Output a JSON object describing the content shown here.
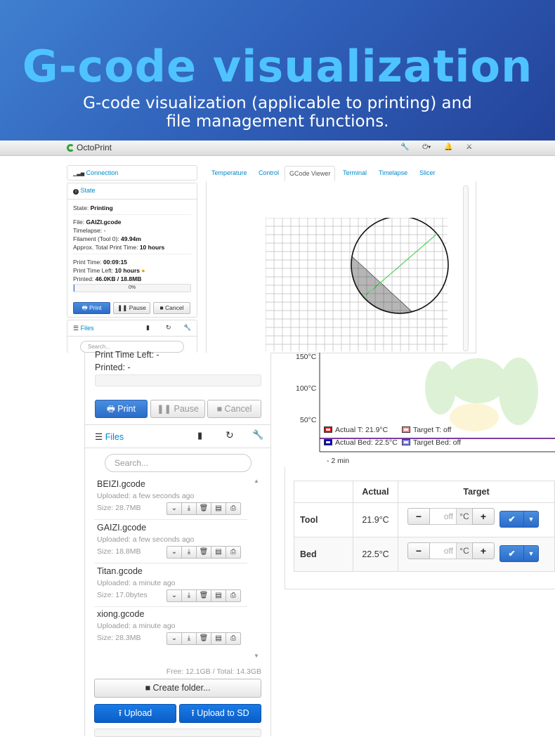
{
  "hero": {
    "title": "G-code visualization",
    "subtitle": "G-code visualization (applicable to printing) and file management functions."
  },
  "navbar": {
    "brand": "OctoPrint",
    "icons": [
      "wrench-icon",
      "power-icon",
      "bell-icon",
      "user-icon"
    ]
  },
  "small_panel": {
    "connection_label": "Connection",
    "state_label": "State",
    "state_row": "Printing",
    "state_prefix": "State:",
    "file_prefix": "File:",
    "file_value": "GAIZI.gcode",
    "timelapse_prefix": "Timelapse:",
    "timelapse_value": "-",
    "filament_prefix": "Filament (Tool 0):",
    "filament_value": "49.94m",
    "approx_prefix": "Approx. Total Print Time:",
    "approx_value": "10 hours",
    "print_time_prefix": "Print Time:",
    "print_time_value": "00:09:15",
    "time_left_prefix": "Print Time Left:",
    "time_left_value": "10 hours",
    "printed_prefix": "Printed:",
    "printed_value": "46.0KB / 18.8MB",
    "progress_text": "0%",
    "progress": 0.0,
    "print_btn": "Print",
    "pause_btn": "Pause",
    "cancel_btn": "Cancel",
    "files_label": "Files",
    "search_placeholder": "Search..."
  },
  "tabs": [
    "Temperature",
    "Control",
    "GCode Viewer",
    "Terminal",
    "Timelapse",
    "Slicer"
  ],
  "big_panel": {
    "time_left_label": "Print Time Left: -",
    "printed_label": "Printed: -",
    "print_btn": "Print",
    "pause_btn": "Pause",
    "cancel_btn": "Cancel",
    "files_label": "Files",
    "search_placeholder": "Search...",
    "files": [
      {
        "name": "BEIZI.gcode",
        "uploaded": "Uploaded: a few seconds ago",
        "size": "Size: 28.7MB"
      },
      {
        "name": "GAIZI.gcode",
        "uploaded": "Uploaded: a few seconds ago",
        "size": "Size: 18.8MB"
      },
      {
        "name": "Titan.gcode",
        "uploaded": "Uploaded: a minute ago",
        "size": "Size: 17.0bytes"
      },
      {
        "name": "xiong.gcode",
        "uploaded": "Uploaded: a minute ago",
        "size": "Size: 28.3MB"
      }
    ],
    "free_total": "Free: 12.1GB / Total: 14.3GB",
    "create_folder": "Create folder...",
    "upload": "Upload",
    "upload_sd": "Upload to SD"
  },
  "chart_data": {
    "type": "line",
    "y_ticks": [
      "150°C",
      "100°C",
      "50°C"
    ],
    "x_label": "- 2 min",
    "legend": [
      "Actual T: 21.9°C",
      "Target T: off",
      "Actual Bed: 22.5°C",
      "Target Bed: off"
    ],
    "series": [
      {
        "name": "Actual T: 21.9°C",
        "color": "#ff0000",
        "values": [
          21.9
        ]
      },
      {
        "name": "Target T: off",
        "color": "#ff7777",
        "values": []
      },
      {
        "name": "Actual Bed: 22.5°C",
        "color": "#0000cc",
        "values": [
          22.5
        ]
      },
      {
        "name": "Target Bed: off",
        "color": "#8888ff",
        "values": []
      }
    ]
  },
  "temp_table": {
    "headers": [
      "",
      "Actual",
      "Target"
    ],
    "rows": [
      {
        "label": "Tool",
        "actual": "21.9°C",
        "target": "off",
        "unit": "°C"
      },
      {
        "label": "Bed",
        "actual": "22.5°C",
        "target": "off",
        "unit": "°C"
      }
    ]
  },
  "colors": {
    "accent": "#0088cc",
    "primary_button": "#2a6cc8",
    "hero_title": "#4fc3ff"
  }
}
